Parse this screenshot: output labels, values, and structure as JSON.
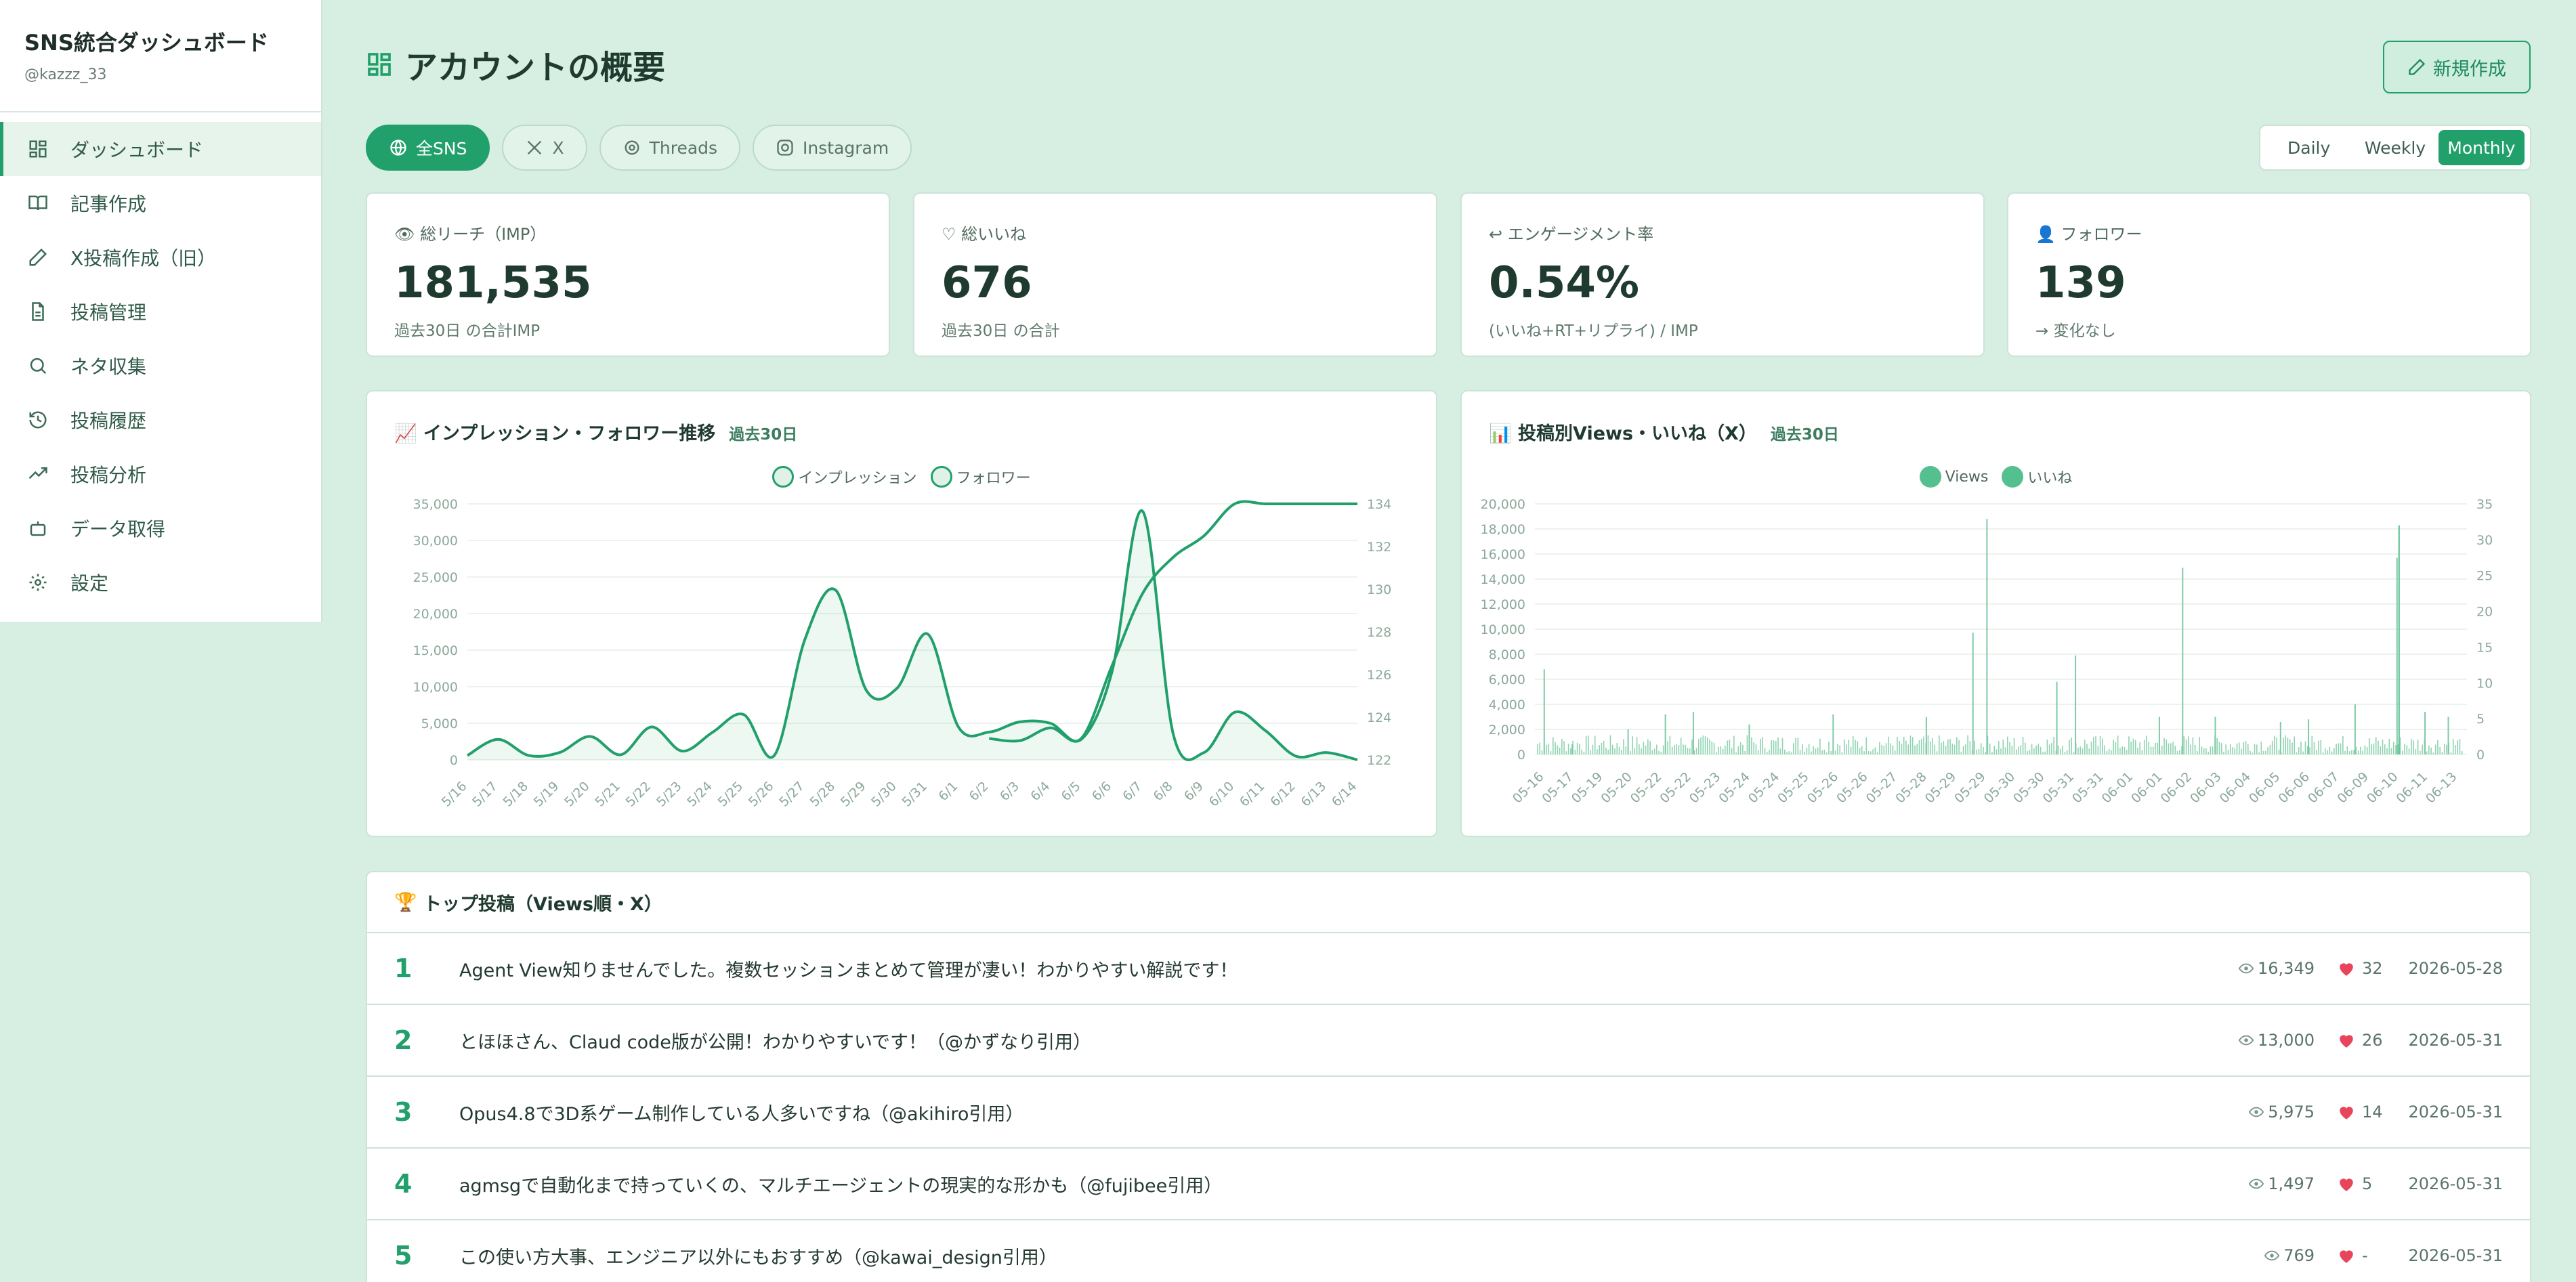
{
  "sidebar": {
    "title": "SNS統合ダッシュボード",
    "user": "@kazzz_33",
    "items": [
      {
        "label": "ダッシュボード",
        "icon": "dashboard-icon"
      },
      {
        "label": "記事作成",
        "icon": "book-icon"
      },
      {
        "label": "X投稿作成（旧）",
        "icon": "pencil-icon"
      },
      {
        "label": "投稿管理",
        "icon": "document-icon"
      },
      {
        "label": "ネタ収集",
        "icon": "search-icon"
      },
      {
        "label": "投稿履歴",
        "icon": "history-icon"
      },
      {
        "label": "投稿分析",
        "icon": "trending-icon"
      },
      {
        "label": "データ取得",
        "icon": "robot-icon"
      },
      {
        "label": "設定",
        "icon": "gear-icon"
      }
    ]
  },
  "header": {
    "title": "アカウントの概要",
    "new_button": "新規作成"
  },
  "filters": {
    "platforms": [
      "全SNS",
      "X",
      "Threads",
      "Instagram"
    ],
    "periods": [
      "Daily",
      "Weekly",
      "Monthly"
    ],
    "selected_period": "Monthly"
  },
  "stats": [
    {
      "icon": "👁",
      "label": "総リーチ（IMP）",
      "value": "181,535",
      "sub": "過去30日 の合計IMP"
    },
    {
      "icon": "♡",
      "label": "総いいね",
      "value": "676",
      "sub": "過去30日 の合計"
    },
    {
      "icon": "↩",
      "label": "エンゲージメント率",
      "value": "0.54%",
      "sub": "(いいね+RT+リプライ) / IMP"
    },
    {
      "icon": "👤",
      "label": "フォロワー",
      "value": "139",
      "sub": "→ 変化なし"
    }
  ],
  "colors": {
    "accent": "#22a06b",
    "background": "#d6efe2",
    "heart": "#e8445a"
  },
  "charts": {
    "impressions": {
      "emoji": "📈",
      "title": "インプレッション・フォロワー推移",
      "span": "過去30日"
    },
    "posts": {
      "emoji": "📊",
      "title": "投稿別Views・いいね（X）",
      "span": "過去30日"
    }
  },
  "chart_data": [
    {
      "type": "line",
      "legend": [
        "インプレッション",
        "フォロワー"
      ],
      "x": [
        "5/16",
        "5/17",
        "5/18",
        "5/19",
        "5/20",
        "5/21",
        "5/22",
        "5/23",
        "5/24",
        "5/25",
        "5/26",
        "5/27",
        "5/28",
        "5/29",
        "5/30",
        "5/31",
        "6/1",
        "6/2",
        "6/3",
        "6/4",
        "6/5",
        "6/6",
        "6/7",
        "6/8",
        "6/9",
        "6/10",
        "6/11",
        "6/12",
        "6/13",
        "6/14"
      ],
      "series": [
        {
          "name": "インプレッション",
          "axis": "left",
          "values": [
            600,
            2800,
            600,
            1000,
            3200,
            700,
            4500,
            1200,
            3800,
            6200,
            600,
            16500,
            23200,
            9500,
            9800,
            17200,
            4500,
            3800,
            5200,
            5000,
            2800,
            12000,
            34000,
            3500,
            1000,
            6500,
            4000,
            500,
            1000,
            0
          ]
        },
        {
          "name": "フォロワー",
          "axis": "right",
          "values": [
            null,
            null,
            null,
            null,
            null,
            null,
            null,
            null,
            null,
            null,
            null,
            null,
            null,
            null,
            null,
            null,
            null,
            123.0,
            122.9,
            123.5,
            123.0,
            126.4,
            129.8,
            131.5,
            132.5,
            134,
            134,
            134,
            134,
            134
          ]
        }
      ],
      "y_left": {
        "min": 0,
        "max": 35000,
        "ticks": [
          "0",
          "5,000",
          "10,000",
          "15,000",
          "20,000",
          "25,000",
          "30,000",
          "35,000"
        ]
      },
      "y_right": {
        "min": 122,
        "max": 134,
        "ticks": [
          "122",
          "124",
          "126",
          "128",
          "130",
          "132",
          "134"
        ]
      }
    },
    {
      "type": "bar",
      "legend": [
        "Views",
        "いいね"
      ],
      "x": [
        "05-16",
        "05-17",
        "05-19",
        "05-20",
        "05-22",
        "05-22",
        "05-23",
        "05-24",
        "05-24",
        "05-25",
        "05-26",
        "05-26",
        "05-27",
        "05-28",
        "05-29",
        "05-29",
        "05-30",
        "05-30",
        "05-31",
        "05-31",
        "06-01",
        "06-01",
        "06-02",
        "06-03",
        "06-04",
        "06-05",
        "06-06",
        "06-07",
        "06-09",
        "06-10",
        "06-11",
        "06-13"
      ],
      "y_left": {
        "min": 0,
        "max": 20000,
        "ticks": [
          "0",
          "2,000",
          "4,000",
          "6,000",
          "8,000",
          "10,000",
          "12,000",
          "14,000",
          "16,000",
          "18,000",
          "20,000"
        ]
      },
      "y_right": {
        "min": 0,
        "max": 35,
        "ticks": [
          "0",
          "5",
          "10",
          "15",
          "20",
          "25",
          "30",
          "35"
        ]
      },
      "views_peaks": [
        {
          "pos": 0.01,
          "value": 6800
        },
        {
          "pos": 0.04,
          "value": 800
        },
        {
          "pos": 0.1,
          "value": 2000
        },
        {
          "pos": 0.14,
          "value": 3200
        },
        {
          "pos": 0.17,
          "value": 3400
        },
        {
          "pos": 0.23,
          "value": 2400
        },
        {
          "pos": 0.32,
          "value": 3200
        },
        {
          "pos": 0.42,
          "value": 3000
        },
        {
          "pos": 0.47,
          "value": 9700
        },
        {
          "pos": 0.485,
          "value": 18800
        },
        {
          "pos": 0.56,
          "value": 5800
        },
        {
          "pos": 0.58,
          "value": 7900
        },
        {
          "pos": 0.67,
          "value": 3000
        },
        {
          "pos": 0.695,
          "value": 14900
        },
        {
          "pos": 0.73,
          "value": 3000
        },
        {
          "pos": 0.8,
          "value": 2600
        },
        {
          "pos": 0.83,
          "value": 2800
        },
        {
          "pos": 0.88,
          "value": 4000
        },
        {
          "pos": 0.925,
          "value": 15700
        },
        {
          "pos": 0.955,
          "value": 3400
        },
        {
          "pos": 0.98,
          "value": 3000
        }
      ],
      "likes_peaks": [
        {
          "pos": 0.925,
          "value": 32
        }
      ]
    }
  ],
  "top_posts": {
    "emoji": "🏆",
    "title": "トップ投稿（Views順・X）",
    "rows": [
      {
        "rank": "1",
        "text": "Agent View知りませんでした。複数セッションまとめて管理が凄い！わかりやすい解説です！",
        "views": "16,349",
        "likes": "32",
        "date": "2026-05-28"
      },
      {
        "rank": "2",
        "text": "とほほさん、Claud code版が公開！わかりやすいです！（@かずなり引用）",
        "views": "13,000",
        "likes": "26",
        "date": "2026-05-31"
      },
      {
        "rank": "3",
        "text": "Opus4.8で3D系ゲーム制作している人多いですね（@akihiro引用）",
        "views": "5,975",
        "likes": "14",
        "date": "2026-05-31"
      },
      {
        "rank": "4",
        "text": "agmsgで自動化まで持っていくの、マルチエージェントの現実的な形かも（@fujibee引用）",
        "views": "1,497",
        "likes": "5",
        "date": "2026-05-31"
      },
      {
        "rank": "5",
        "text": "この使い方大事、エンジニア以外にもおすすめ（@kawai_design引用）",
        "views": "769",
        "likes": "-",
        "date": "2026-05-31"
      }
    ]
  }
}
